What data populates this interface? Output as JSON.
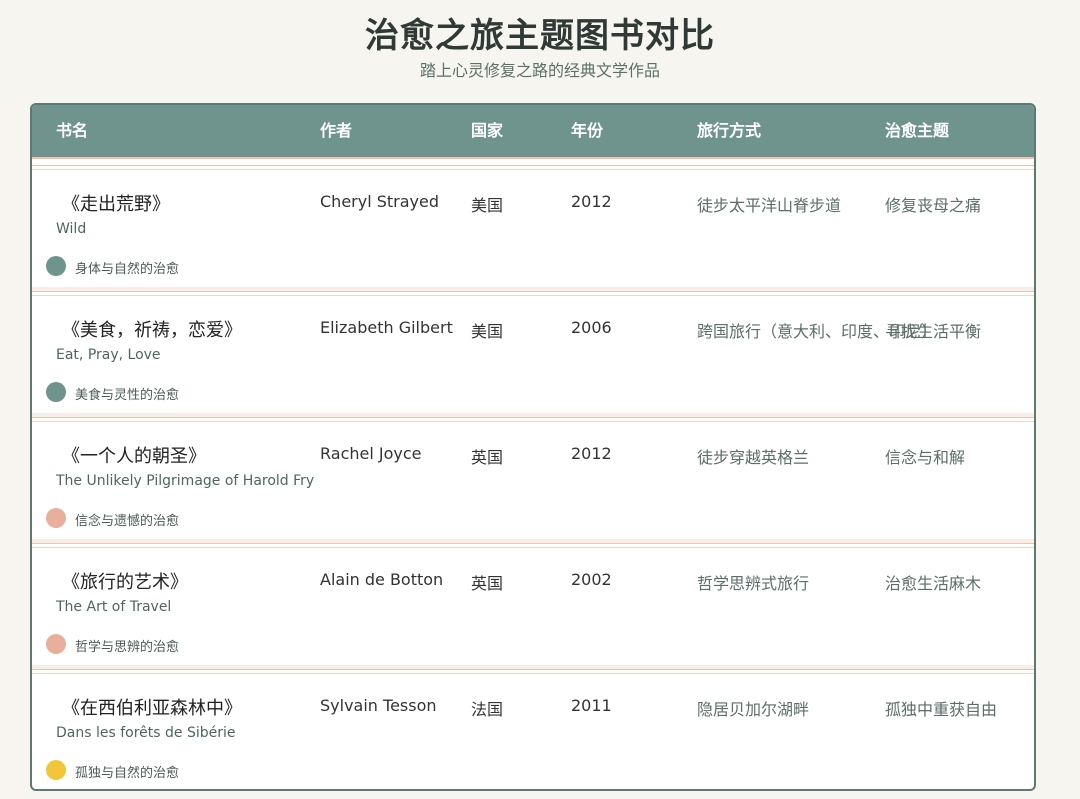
{
  "page": {
    "title": "治愈之旅主题图书对比",
    "subtitle": "踏上心灵修复之路的经典文学作品"
  },
  "table": {
    "headers": [
      "书名",
      "作者",
      "国家",
      "年份",
      "旅行方式",
      "治愈主题"
    ],
    "rows": [
      {
        "title_cn": "《走出荒野》",
        "title_en": "Wild",
        "theme_label": "身体与自然的治愈",
        "dot_color": "#6e948d",
        "author": "Cheryl Strayed",
        "country": "美国",
        "year": "2012",
        "travel": "徒步太平洋山脊步道",
        "healing": "修复丧母之痛"
      },
      {
        "title_cn": "《美食，祈祷，恋爱》",
        "title_en": "Eat, Pray, Love",
        "theme_label": "美食与灵性的治愈",
        "dot_color": "#6e948d",
        "author": "Elizabeth Gilbert",
        "country": "美国",
        "year": "2006",
        "travel": "跨国旅行（意大利、印度、印尼）",
        "healing": "寻找生活平衡"
      },
      {
        "title_cn": "《一个人的朝圣》",
        "title_en": "The Unlikely Pilgrimage of Harold Fry",
        "theme_label": "信念与遗憾的治愈",
        "dot_color": "#e8b09c",
        "author": "Rachel Joyce",
        "country": "英国",
        "year": "2012",
        "travel": "徒步穿越英格兰",
        "healing": "信念与和解"
      },
      {
        "title_cn": "《旅行的艺术》",
        "title_en": "The Art of Travel",
        "theme_label": "哲学与思辨的治愈",
        "dot_color": "#e8b09c",
        "author": "Alain de Botton",
        "country": "英国",
        "year": "2002",
        "travel": "哲学思辨式旅行",
        "healing": "治愈生活麻木"
      },
      {
        "title_cn": "《在西伯利亚森林中》",
        "title_en": "Dans les forêts de Sibérie",
        "theme_label": "孤独与自然的治愈",
        "dot_color": "#f2c63a",
        "author": "Sylvain Tesson",
        "country": "法国",
        "year": "2011",
        "travel": "隐居贝加尔湖畔",
        "healing": "孤独中重获自由"
      }
    ]
  }
}
